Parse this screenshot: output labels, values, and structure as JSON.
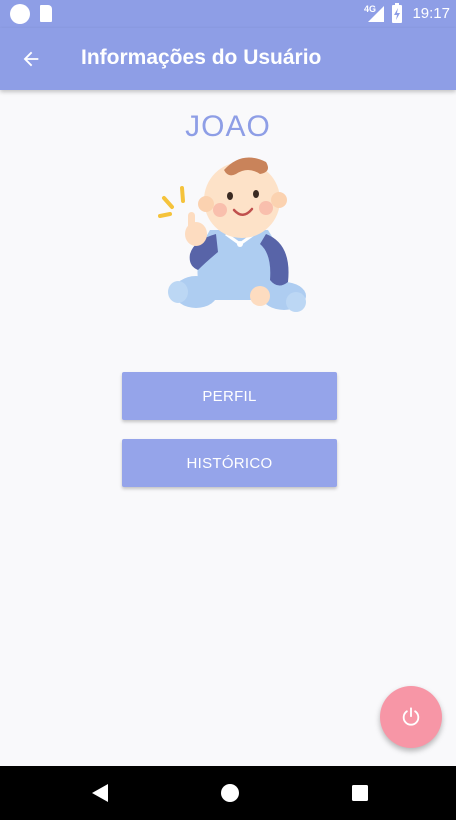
{
  "status_bar": {
    "network_label": "4G",
    "time": "19:17",
    "icons": [
      "circle-notification-icon",
      "sd-card-icon",
      "signal-icon",
      "battery-charging-icon"
    ]
  },
  "app_bar": {
    "title": "Informações do Usuário",
    "back_icon": "arrow-left-icon"
  },
  "user": {
    "name": "JOAO",
    "avatar_icon": "baby-avatar-icon"
  },
  "buttons": {
    "perfil_label": "PERFIL",
    "historico_label": "HISTÓRICO"
  },
  "fab": {
    "icon": "power-icon"
  },
  "nav_bar": {
    "icons": [
      "nav-back-icon",
      "nav-home-icon",
      "nav-recents-icon"
    ]
  },
  "colors": {
    "primary": "#8e9ee6",
    "button": "#95a4ea",
    "accent": "#f796a6",
    "background": "#f9f9fb"
  }
}
